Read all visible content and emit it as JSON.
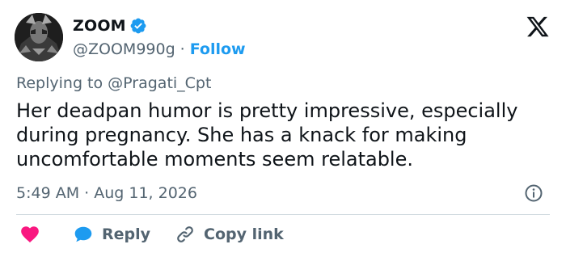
{
  "user": {
    "name": "ZOOM",
    "handle": "@ZOOM990g",
    "separator": "·",
    "follow_label": "Follow"
  },
  "tweet": {
    "reply_prefix": "Replying to ",
    "reply_mention": "@Pragati_Cpt",
    "text": "Her deadpan humor is pretty impressive, especially during pregnancy. She has a knack for making uncomfortable moments seem relatable.",
    "timestamp": "5:49 AM · Aug 11, 2026"
  },
  "actions": {
    "reply_label": "Reply",
    "copy_link_label": "Copy link"
  },
  "icons": {
    "verified": "verified-badge-icon",
    "brand": "x-logo-icon",
    "info": "info-icon",
    "like": "heart-icon",
    "reply": "speech-bubble-icon",
    "link": "link-icon"
  },
  "colors": {
    "accent": "#1d9bf0",
    "like": "#f91880",
    "muted": "#536471",
    "text": "#0f1419",
    "divider": "#cfd9de"
  }
}
